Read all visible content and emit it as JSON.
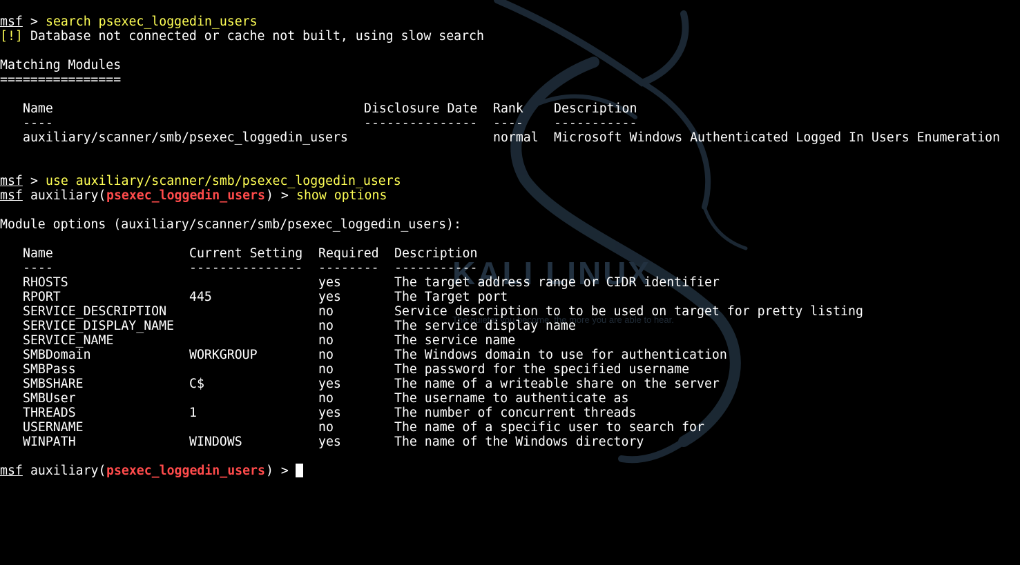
{
  "colors": {
    "background": "#000000",
    "text": "#ffffff",
    "command": "#ffff55",
    "module_name": "#ff4b4b"
  },
  "prompt": {
    "msf": "msf",
    "arrow": " > ",
    "auxiliary_prefix": " auxiliary(",
    "auxiliary_suffix": ") > ",
    "module": "psexec_loggedin_users"
  },
  "session": {
    "cmd_search": "search psexec_loggedin_users",
    "warn_tag": "[!]",
    "warn_text": " Database not connected or cache not built, using slow search",
    "matching_heading": "Matching Modules",
    "matching_rule": "================",
    "cmd_use": "use auxiliary/scanner/smb/psexec_loggedin_users",
    "cmd_show": "show options",
    "options_heading": "Module options (auxiliary/scanner/smb/psexec_loggedin_users):"
  },
  "modules_table": {
    "headers": [
      "Name",
      "Disclosure Date",
      "Rank",
      "Description"
    ],
    "dashes": [
      "----",
      "---------------",
      "----",
      "-----------"
    ],
    "rows": [
      {
        "name": "auxiliary/scanner/smb/psexec_loggedin_users",
        "disclosure_date": "",
        "rank": "normal",
        "description": "Microsoft Windows Authenticated Logged In Users Enumeration"
      }
    ]
  },
  "options_table": {
    "headers": [
      "Name",
      "Current Setting",
      "Required",
      "Description"
    ],
    "dashes": [
      "----",
      "---------------",
      "--------",
      "-----------"
    ],
    "rows": [
      {
        "name": "RHOSTS",
        "setting": "",
        "required": "yes",
        "description": "The target address range or CIDR identifier"
      },
      {
        "name": "RPORT",
        "setting": "445",
        "required": "yes",
        "description": "The Target port"
      },
      {
        "name": "SERVICE_DESCRIPTION",
        "setting": "",
        "required": "no",
        "description": "Service description to to be used on target for pretty listing"
      },
      {
        "name": "SERVICE_DISPLAY_NAME",
        "setting": "",
        "required": "no",
        "description": "The service display name"
      },
      {
        "name": "SERVICE_NAME",
        "setting": "",
        "required": "no",
        "description": "The service name"
      },
      {
        "name": "SMBDomain",
        "setting": "WORKGROUP",
        "required": "no",
        "description": "The Windows domain to use for authentication"
      },
      {
        "name": "SMBPass",
        "setting": "",
        "required": "no",
        "description": "The password for the specified username"
      },
      {
        "name": "SMBSHARE",
        "setting": "C$",
        "required": "yes",
        "description": "The name of a writeable share on the server"
      },
      {
        "name": "SMBUser",
        "setting": "",
        "required": "no",
        "description": "The username to authenticate as"
      },
      {
        "name": "THREADS",
        "setting": "1",
        "required": "yes",
        "description": "The number of concurrent threads"
      },
      {
        "name": "USERNAME",
        "setting": "",
        "required": "no",
        "description": "The name of a specific user to search for"
      },
      {
        "name": "WINPATH",
        "setting": "WINDOWS",
        "required": "yes",
        "description": "The name of the Windows directory"
      }
    ]
  },
  "wallpaper": {
    "logo_text": "KALI LINUX",
    "tagline": "The quieter you become, the more you are able to hear.",
    "icon": "kali-dragon-icon"
  }
}
